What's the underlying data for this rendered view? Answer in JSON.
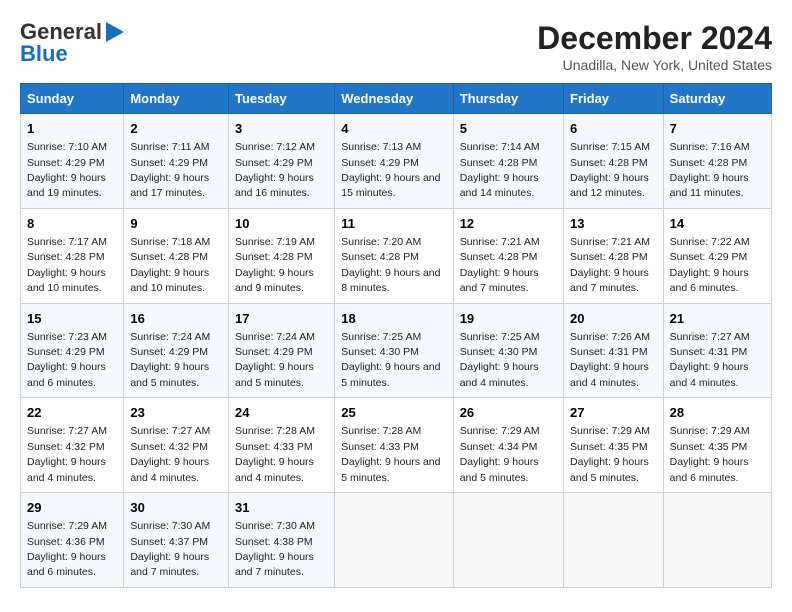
{
  "logo": {
    "line1": "General",
    "line2": "Blue"
  },
  "title": "December 2024",
  "subtitle": "Unadilla, New York, United States",
  "days_of_week": [
    "Sunday",
    "Monday",
    "Tuesday",
    "Wednesday",
    "Thursday",
    "Friday",
    "Saturday"
  ],
  "weeks": [
    [
      {
        "day": "1",
        "info": "Sunrise: 7:10 AM\nSunset: 4:29 PM\nDaylight: 9 hours and 19 minutes."
      },
      {
        "day": "2",
        "info": "Sunrise: 7:11 AM\nSunset: 4:29 PM\nDaylight: 9 hours and 17 minutes."
      },
      {
        "day": "3",
        "info": "Sunrise: 7:12 AM\nSunset: 4:29 PM\nDaylight: 9 hours and 16 minutes."
      },
      {
        "day": "4",
        "info": "Sunrise: 7:13 AM\nSunset: 4:29 PM\nDaylight: 9 hours and 15 minutes."
      },
      {
        "day": "5",
        "info": "Sunrise: 7:14 AM\nSunset: 4:28 PM\nDaylight: 9 hours and 14 minutes."
      },
      {
        "day": "6",
        "info": "Sunrise: 7:15 AM\nSunset: 4:28 PM\nDaylight: 9 hours and 12 minutes."
      },
      {
        "day": "7",
        "info": "Sunrise: 7:16 AM\nSunset: 4:28 PM\nDaylight: 9 hours and 11 minutes."
      }
    ],
    [
      {
        "day": "8",
        "info": "Sunrise: 7:17 AM\nSunset: 4:28 PM\nDaylight: 9 hours and 10 minutes."
      },
      {
        "day": "9",
        "info": "Sunrise: 7:18 AM\nSunset: 4:28 PM\nDaylight: 9 hours and 10 minutes."
      },
      {
        "day": "10",
        "info": "Sunrise: 7:19 AM\nSunset: 4:28 PM\nDaylight: 9 hours and 9 minutes."
      },
      {
        "day": "11",
        "info": "Sunrise: 7:20 AM\nSunset: 4:28 PM\nDaylight: 9 hours and 8 minutes."
      },
      {
        "day": "12",
        "info": "Sunrise: 7:21 AM\nSunset: 4:28 PM\nDaylight: 9 hours and 7 minutes."
      },
      {
        "day": "13",
        "info": "Sunrise: 7:21 AM\nSunset: 4:28 PM\nDaylight: 9 hours and 7 minutes."
      },
      {
        "day": "14",
        "info": "Sunrise: 7:22 AM\nSunset: 4:29 PM\nDaylight: 9 hours and 6 minutes."
      }
    ],
    [
      {
        "day": "15",
        "info": "Sunrise: 7:23 AM\nSunset: 4:29 PM\nDaylight: 9 hours and 6 minutes."
      },
      {
        "day": "16",
        "info": "Sunrise: 7:24 AM\nSunset: 4:29 PM\nDaylight: 9 hours and 5 minutes."
      },
      {
        "day": "17",
        "info": "Sunrise: 7:24 AM\nSunset: 4:29 PM\nDaylight: 9 hours and 5 minutes."
      },
      {
        "day": "18",
        "info": "Sunrise: 7:25 AM\nSunset: 4:30 PM\nDaylight: 9 hours and 5 minutes."
      },
      {
        "day": "19",
        "info": "Sunrise: 7:25 AM\nSunset: 4:30 PM\nDaylight: 9 hours and 4 minutes."
      },
      {
        "day": "20",
        "info": "Sunrise: 7:26 AM\nSunset: 4:31 PM\nDaylight: 9 hours and 4 minutes."
      },
      {
        "day": "21",
        "info": "Sunrise: 7:27 AM\nSunset: 4:31 PM\nDaylight: 9 hours and 4 minutes."
      }
    ],
    [
      {
        "day": "22",
        "info": "Sunrise: 7:27 AM\nSunset: 4:32 PM\nDaylight: 9 hours and 4 minutes."
      },
      {
        "day": "23",
        "info": "Sunrise: 7:27 AM\nSunset: 4:32 PM\nDaylight: 9 hours and 4 minutes."
      },
      {
        "day": "24",
        "info": "Sunrise: 7:28 AM\nSunset: 4:33 PM\nDaylight: 9 hours and 4 minutes."
      },
      {
        "day": "25",
        "info": "Sunrise: 7:28 AM\nSunset: 4:33 PM\nDaylight: 9 hours and 5 minutes."
      },
      {
        "day": "26",
        "info": "Sunrise: 7:29 AM\nSunset: 4:34 PM\nDaylight: 9 hours and 5 minutes."
      },
      {
        "day": "27",
        "info": "Sunrise: 7:29 AM\nSunset: 4:35 PM\nDaylight: 9 hours and 5 minutes."
      },
      {
        "day": "28",
        "info": "Sunrise: 7:29 AM\nSunset: 4:35 PM\nDaylight: 9 hours and 6 minutes."
      }
    ],
    [
      {
        "day": "29",
        "info": "Sunrise: 7:29 AM\nSunset: 4:36 PM\nDaylight: 9 hours and 6 minutes."
      },
      {
        "day": "30",
        "info": "Sunrise: 7:30 AM\nSunset: 4:37 PM\nDaylight: 9 hours and 7 minutes."
      },
      {
        "day": "31",
        "info": "Sunrise: 7:30 AM\nSunset: 4:38 PM\nDaylight: 9 hours and 7 minutes."
      },
      null,
      null,
      null,
      null
    ]
  ]
}
